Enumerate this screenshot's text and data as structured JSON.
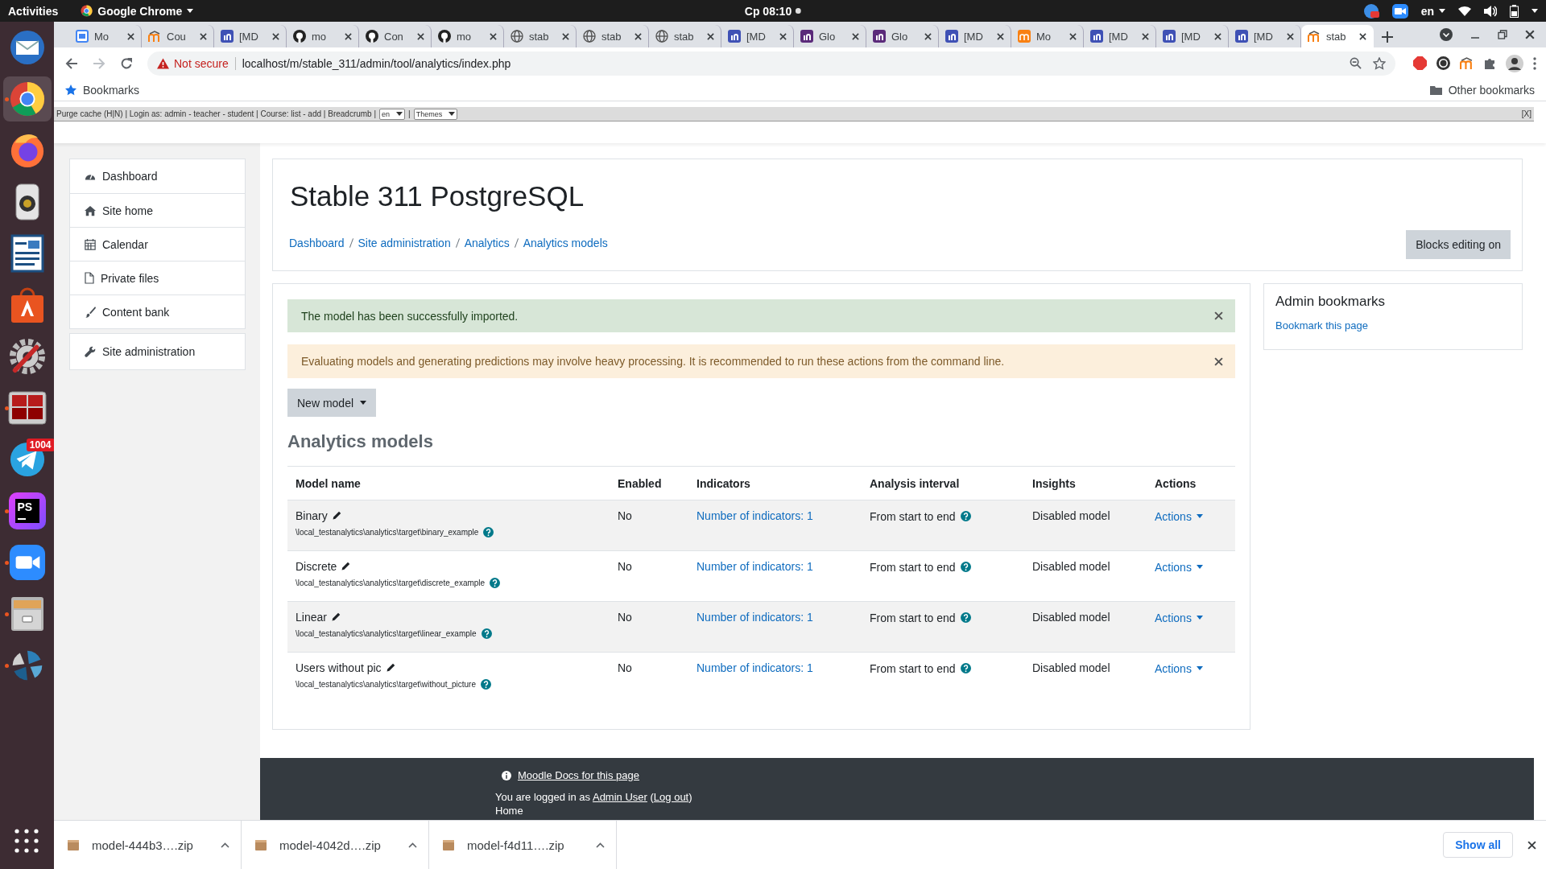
{
  "top_bar": {
    "activities": "Activities",
    "app_menu": "Google Chrome",
    "clock": "Cp 08:10",
    "language": "en"
  },
  "dock": [
    {
      "kind": "mail",
      "active": false,
      "running": false
    },
    {
      "kind": "chrome",
      "active": true,
      "running": true
    },
    {
      "kind": "firefox",
      "active": false,
      "running": false
    },
    {
      "kind": "speaker",
      "active": false,
      "running": false
    },
    {
      "kind": "writer",
      "active": false,
      "running": false
    },
    {
      "kind": "store",
      "active": false,
      "running": false
    },
    {
      "kind": "settings",
      "active": false,
      "running": false
    },
    {
      "kind": "terminal",
      "active": false,
      "running": true
    },
    {
      "kind": "telegram",
      "active": false,
      "running": false,
      "badge": "1004"
    },
    {
      "kind": "phpstorm",
      "active": false,
      "running": true,
      "label": "PS"
    },
    {
      "kind": "zoom",
      "active": false,
      "running": true
    },
    {
      "kind": "files",
      "active": false,
      "running": true
    },
    {
      "kind": "shutter",
      "active": false,
      "running": true
    }
  ],
  "tabs": [
    {
      "label": "Mo",
      "kind": "calendar",
      "selected": false
    },
    {
      "label": "Cou",
      "kind": "moodle",
      "selected": false
    },
    {
      "label": "[MD",
      "kind": "tracker",
      "selected": false
    },
    {
      "label": "mo",
      "kind": "github",
      "selected": false
    },
    {
      "label": "Con",
      "kind": "github",
      "selected": false
    },
    {
      "label": "mo",
      "kind": "github",
      "selected": false
    },
    {
      "label": "stab",
      "kind": "globe",
      "selected": false
    },
    {
      "label": "stab",
      "kind": "globe",
      "selected": false
    },
    {
      "label": "stab",
      "kind": "globe",
      "selected": false
    },
    {
      "label": "[MD",
      "kind": "tracker",
      "selected": false
    },
    {
      "label": "Glo",
      "kind": "wiki",
      "selected": false
    },
    {
      "label": "Glo",
      "kind": "wiki",
      "selected": false
    },
    {
      "label": "[MD",
      "kind": "tracker",
      "selected": false
    },
    {
      "label": "Mo",
      "kind": "moodlebox",
      "selected": false
    },
    {
      "label": "[MD",
      "kind": "tracker",
      "selected": false
    },
    {
      "label": "[MD",
      "kind": "tracker",
      "selected": false
    },
    {
      "label": "[MD",
      "kind": "tracker",
      "selected": false
    },
    {
      "label": "stab",
      "kind": "moodle",
      "selected": true
    }
  ],
  "address_bar": {
    "security": "Not secure",
    "url": "localhost/m/stable_311/admin/tool/analytics/index.php"
  },
  "bookmarks_bar": {
    "label": "Bookmarks",
    "other": "Other bookmarks"
  },
  "dev_bar": {
    "text": "Purge cache (H|N) | Login as: admin - teacher - student | Course: list - add | Breadcrumb |",
    "language": "en",
    "separator": "|",
    "theme": "Themes",
    "close": "[X]"
  },
  "sidebar": {
    "items": [
      {
        "label": "Dashboard",
        "kind": "dashboard"
      },
      {
        "label": "Site home",
        "kind": "home"
      },
      {
        "label": "Calendar",
        "kind": "calendar"
      },
      {
        "label": "Private files",
        "kind": "file"
      },
      {
        "label": "Content bank",
        "kind": "brush"
      }
    ],
    "admin_items": [
      {
        "label": "Site administration",
        "kind": "wrench"
      }
    ]
  },
  "header": {
    "title": "Stable 311 PostgreSQL",
    "breadcrumb": [
      "Dashboard",
      "Site administration",
      "Analytics",
      "Analytics models"
    ],
    "button": "Blocks editing on"
  },
  "alerts": [
    {
      "kind": "success",
      "text": "The model has been successfully imported."
    },
    {
      "kind": "warning",
      "text": "Evaluating models and generating predictions may involve heavy processing. It is recommended to run these actions from the command line."
    }
  ],
  "new_model_button": "New model",
  "heading": "Analytics models",
  "table": {
    "columns": [
      "Model name",
      "Enabled",
      "Indicators",
      "Analysis interval",
      "Insights",
      "Actions"
    ],
    "rows": [
      {
        "name": "Binary",
        "target": "\\local_testanalytics\\analytics\\target\\binary_example",
        "enabled": "No",
        "indicators": "Number of indicators: 1",
        "interval": "From start to end",
        "insights": "Disabled model",
        "actions": "Actions"
      },
      {
        "name": "Discrete",
        "target": "\\local_testanalytics\\analytics\\target\\discrete_example",
        "enabled": "No",
        "indicators": "Number of indicators: 1",
        "interval": "From start to end",
        "insights": "Disabled model",
        "actions": "Actions"
      },
      {
        "name": "Linear",
        "target": "\\local_testanalytics\\analytics\\target\\linear_example",
        "enabled": "No",
        "indicators": "Number of indicators: 1",
        "interval": "From start to end",
        "insights": "Disabled model",
        "actions": "Actions"
      },
      {
        "name": "Users without pic",
        "target": "\\local_testanalytics\\analytics\\target\\without_picture",
        "enabled": "No",
        "indicators": "Number of indicators: 1",
        "interval": "From start to end",
        "insights": "Disabled model",
        "actions": "Actions"
      }
    ]
  },
  "admin_bookmarks": {
    "title": "Admin bookmarks",
    "link": "Bookmark this page"
  },
  "footer": {
    "docs_link": "Moodle Docs for this page",
    "login": [
      {
        "kind": "text",
        "text": "You are logged in as "
      },
      {
        "kind": "link",
        "text": "Admin User"
      },
      {
        "kind": "text",
        "text": " ("
      },
      {
        "kind": "link",
        "text": "Log out"
      },
      {
        "kind": "text",
        "text": ")"
      }
    ],
    "home_link": "Home"
  },
  "downloads": {
    "items": [
      "model-444b3….zip",
      "model-4042d….zip",
      "model-f4d11….zip"
    ],
    "show_all": "Show all"
  }
}
